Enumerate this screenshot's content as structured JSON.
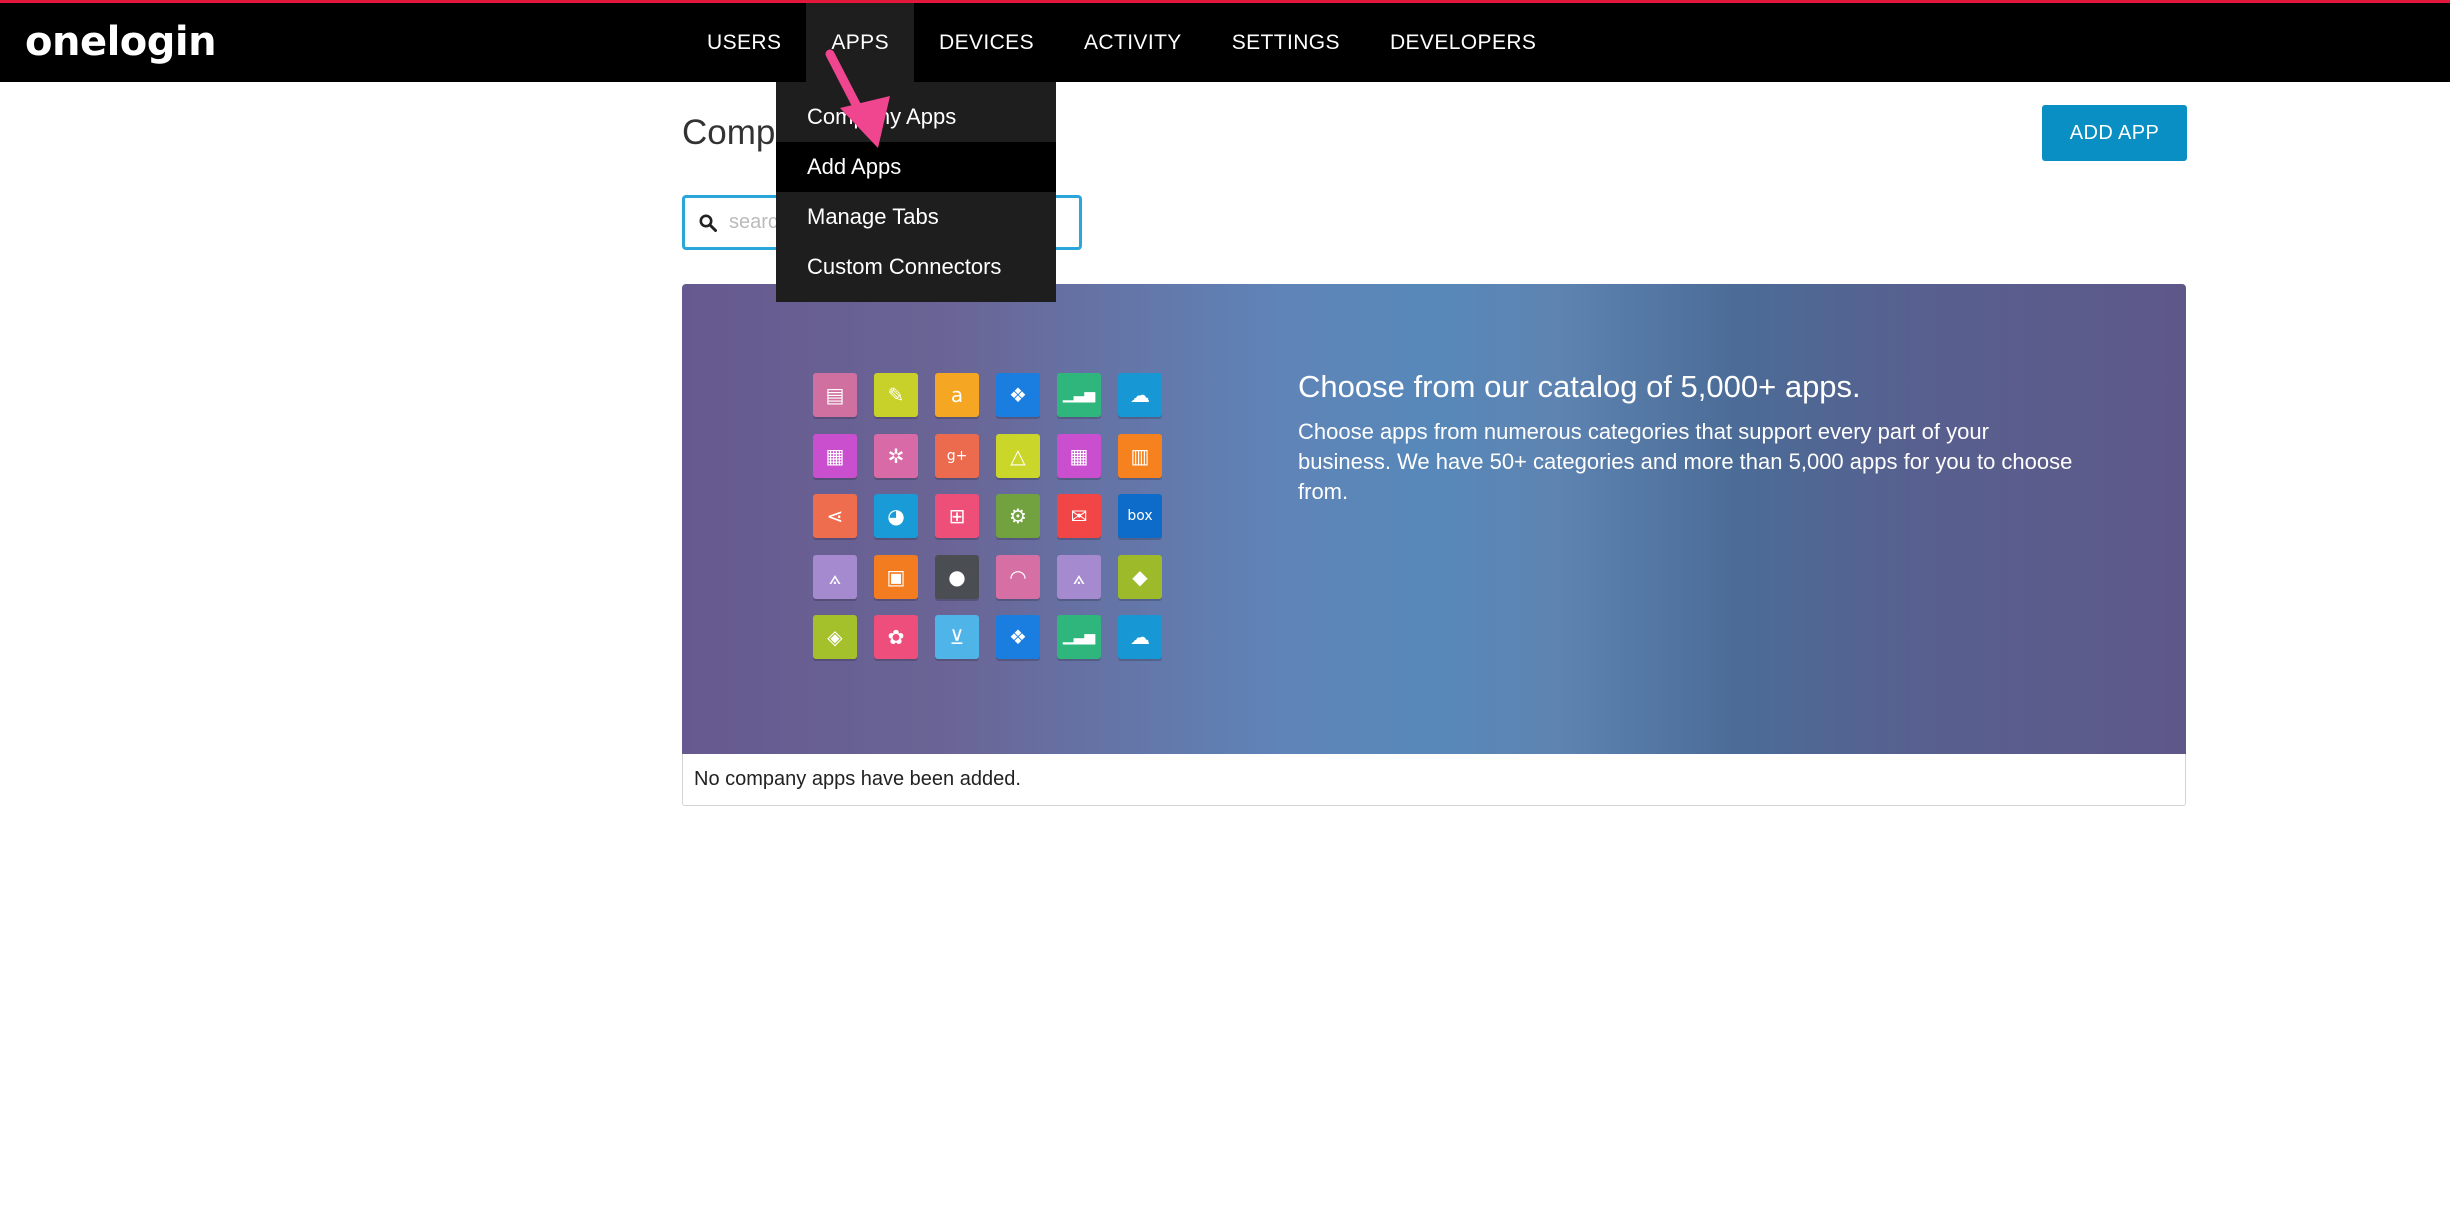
{
  "app": {
    "logo": "onelogin",
    "accent_color": "#e2173a"
  },
  "nav": {
    "items": [
      {
        "label": "USERS",
        "active": false
      },
      {
        "label": "APPS",
        "active": true
      },
      {
        "label": "DEVICES",
        "active": false
      },
      {
        "label": "ACTIVITY",
        "active": false
      },
      {
        "label": "SETTINGS",
        "active": false
      },
      {
        "label": "DEVELOPERS",
        "active": false
      }
    ]
  },
  "apps_menu": {
    "items": [
      {
        "label": "Company Apps",
        "hovered": false
      },
      {
        "label": "Add Apps",
        "hovered": true
      },
      {
        "label": "Manage Tabs",
        "hovered": false
      },
      {
        "label": "Custom Connectors",
        "hovered": false
      }
    ]
  },
  "page": {
    "title": "Company Apps",
    "add_button": "ADD APP",
    "button_color": "#0a8fc4",
    "search_placeholder": "search"
  },
  "hero": {
    "title": "Choose from our catalog of 5,000+ apps.",
    "text": "Choose apps from numerous categories that support every part of your business. We have 50+ categories and more than 5,000 apps for you to choose from.",
    "tiles": [
      {
        "icon": "card-icon",
        "glyph": "▤",
        "color": "#d070a0"
      },
      {
        "icon": "brush-icon",
        "glyph": "✎",
        "color": "#c8d12a"
      },
      {
        "icon": "amazon-icon",
        "glyph": "a",
        "color": "#f5a623"
      },
      {
        "icon": "dropbox-icon",
        "glyph": "❖",
        "color": "#1a7de0"
      },
      {
        "icon": "chart-icon",
        "glyph": "▁▃▅",
        "color": "#2fb67c"
      },
      {
        "icon": "salesforce-icon",
        "glyph": "☁",
        "color": "#1797d4"
      },
      {
        "icon": "calendar-icon",
        "glyph": "▦",
        "color": "#c94fcf"
      },
      {
        "icon": "network-icon",
        "glyph": "✲",
        "color": "#d96aa8"
      },
      {
        "icon": "google-plus-icon",
        "glyph": "g+",
        "color": "#ec6b4f"
      },
      {
        "icon": "drive-icon",
        "glyph": "△",
        "color": "#cbd62a"
      },
      {
        "icon": "calendar-icon",
        "glyph": "▦",
        "color": "#c94fcf"
      },
      {
        "icon": "layout-icon",
        "glyph": "▥",
        "color": "#f5821f"
      },
      {
        "icon": "share-icon",
        "glyph": "⋖",
        "color": "#ef6d4f"
      },
      {
        "icon": "pie-chart-icon",
        "glyph": "◕",
        "color": "#189bd7"
      },
      {
        "icon": "windows-icon",
        "glyph": "⊞",
        "color": "#ed4f78"
      },
      {
        "icon": "gear-icon",
        "glyph": "⚙",
        "color": "#72a13f"
      },
      {
        "icon": "mail-icon",
        "glyph": "✉",
        "color": "#f24646"
      },
      {
        "icon": "box-icon",
        "glyph": "box",
        "color": "#0d6cc9"
      },
      {
        "icon": "app-store-icon",
        "glyph": "⟑",
        "color": "#a68ad0"
      },
      {
        "icon": "save-icon",
        "glyph": "▣",
        "color": "#f47c20"
      },
      {
        "icon": "apple-icon",
        "glyph": "●",
        "color": "#4a4e53"
      },
      {
        "icon": "rss-icon",
        "glyph": "◠",
        "color": "#d56fa4"
      },
      {
        "icon": "app-store-icon",
        "glyph": "⟑",
        "color": "#a68ad0"
      },
      {
        "icon": "android-icon",
        "glyph": "◆",
        "color": "#9cba2a"
      },
      {
        "icon": "tag-icon",
        "glyph": "◈",
        "color": "#a4c02a"
      },
      {
        "icon": "chat-icon",
        "glyph": "✿",
        "color": "#ee4e7c"
      },
      {
        "icon": "funnel-icon",
        "glyph": "⊻",
        "color": "#4fb5e8"
      },
      {
        "icon": "dropbox-icon",
        "glyph": "❖",
        "color": "#1a7de0"
      },
      {
        "icon": "chart-icon",
        "glyph": "▁▃▅",
        "color": "#2fb67c"
      },
      {
        "icon": "salesforce-icon",
        "glyph": "☁",
        "color": "#1797d4"
      }
    ]
  },
  "empty_message": "No company apps have been added."
}
